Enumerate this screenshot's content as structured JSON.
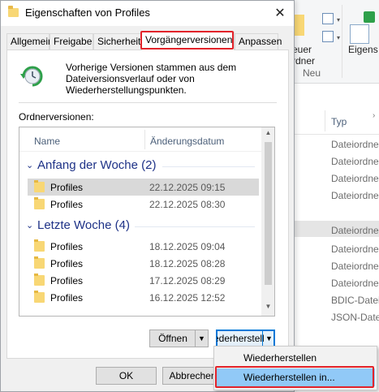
{
  "dialog": {
    "title": "Eigenschaften von Profiles",
    "tabs": [
      "Allgemein",
      "Freigabe",
      "Sicherheit",
      "Vorgängerversionen",
      "Anpassen"
    ],
    "active_tab": "Vorgängerversionen",
    "description": "Vorherige Versionen stammen aus dem Dateiversionsverlauf oder von Wiederherstellungspunkten.",
    "versions_label": "Ordnerversionen:",
    "columns": {
      "name": "Name",
      "date": "Änderungsdatum"
    },
    "groups": [
      {
        "title": "Anfang der Woche (2)",
        "rows": [
          {
            "name": "Profiles",
            "date": "22.12.2025 09:15",
            "selected": true
          },
          {
            "name": "Profiles",
            "date": "22.12.2025 08:30",
            "selected": false
          }
        ]
      },
      {
        "title": "Letzte Woche (4)",
        "rows": [
          {
            "name": "Profiles",
            "date": "18.12.2025 09:04",
            "selected": false
          },
          {
            "name": "Profiles",
            "date": "18.12.2025 08:28",
            "selected": false
          },
          {
            "name": "Profiles",
            "date": "17.12.2025 08:29",
            "selected": false
          },
          {
            "name": "Profiles",
            "date": "16.12.2025 12:52",
            "selected": false
          }
        ]
      }
    ],
    "buttons": {
      "open": "Öffnen",
      "restore": "ederherstell",
      "ok": "OK",
      "cancel": "Abbrechen"
    },
    "menu": [
      "Wiederherstellen",
      "Wiederherstellen in..."
    ]
  },
  "explorer": {
    "ribbon_new_folder": [
      "euer",
      "rdner"
    ],
    "ribbon_properties": "Eigens",
    "ribbon_group": "Neu",
    "column_type": "Typ",
    "types": [
      "Dateiordne",
      "Dateiordne",
      "Dateiordne",
      "Dateiordne",
      "Dateiordne",
      "Dateiordne",
      "BDIC-Datei",
      "JSON-Datei"
    ]
  },
  "colors": {
    "accent": "#0078d7",
    "highlight_box": "#e2232a",
    "group_header": "#1e3287",
    "menu_hover": "#91c9f7",
    "folder": "#f8d775"
  }
}
